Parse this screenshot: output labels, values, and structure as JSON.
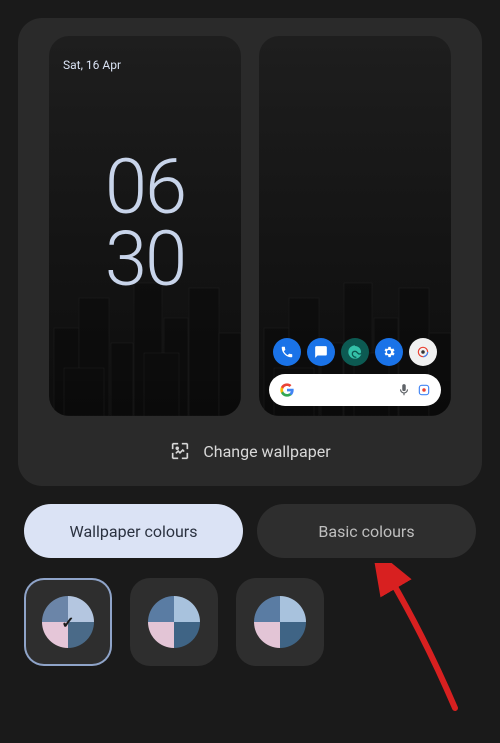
{
  "preview": {
    "lockscreen": {
      "date": "Sat, 16 Apr",
      "hours": "06",
      "minutes": "30"
    },
    "homescreen": {
      "apps": [
        "phone",
        "messages",
        "edge",
        "settings",
        "camera"
      ]
    }
  },
  "actions": {
    "change_wallpaper_label": "Change wallpaper"
  },
  "tabs": {
    "wallpaper_colours": "Wallpaper colours",
    "basic_colours": "Basic colours",
    "selected": "wallpaper_colours"
  },
  "swatches": [
    {
      "colors": [
        "#6b85a8",
        "#b4c6e0",
        "#e5c6d8",
        "#4a6a88"
      ],
      "selected": true
    },
    {
      "colors": [
        "#5a7ca3",
        "#a8c2dd",
        "#e3c5d6",
        "#3f6485"
      ],
      "selected": false
    },
    {
      "colors": [
        "#5a7ca3",
        "#a8c2dd",
        "#e3c5d6",
        "#3f6485"
      ],
      "selected": false
    }
  ],
  "annotation": {
    "arrow_color": "#d82020",
    "target": "basic_colours"
  }
}
